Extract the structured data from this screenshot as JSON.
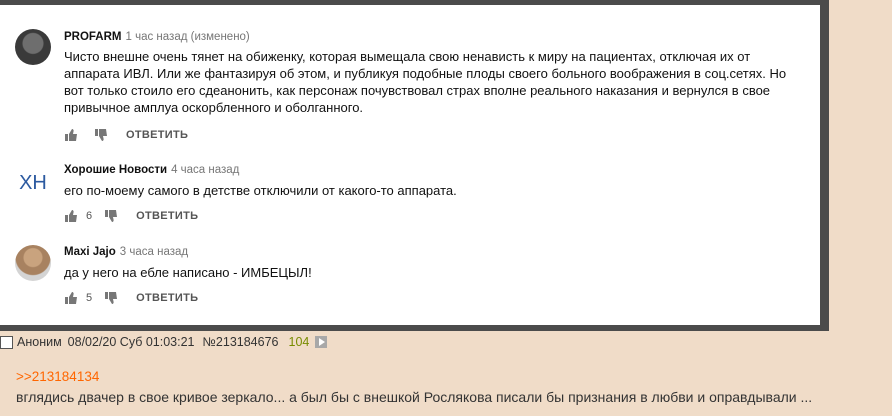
{
  "comments": [
    {
      "author": "PROFARM",
      "time": "1 час назад (изменено)",
      "text": "Чисто внешне очень тянет на обиженку, которая вымещала свою ненависть к миру на пациентах, отключая их от аппарата ИВЛ. Или же фантазируя об этом, и публикуя подобные плоды своего больного воображения в соц.сетях. Но вот только стоило его сдеанонить, как персонаж почувствовал страх вполне реального наказания и вернулся в свое привычное амплуа оскорбленного и оболганного.",
      "likes": "",
      "reply_label": "ОТВЕТИТЬ"
    },
    {
      "author": "Хорошие Новости",
      "time": "4 часа назад",
      "text": "его по-моему самого в детстве отключили от какого-то аппарата.",
      "likes": "6",
      "reply_label": "ОТВЕТИТЬ",
      "avatar_text": "ХН"
    },
    {
      "author": "Maxi Jajo",
      "time": "3 часа назад",
      "text": "да у него на ебле написано - ИМБЕЦЫЛ!",
      "likes": "5",
      "reply_label": "ОТВЕТИТЬ"
    }
  ],
  "post": {
    "author": "Аноним",
    "date": "08/02/20 Суб 01:03:21",
    "number": "№213184676",
    "replies": "104",
    "quote": ">>213184134",
    "text": "вглядись двачер в свое кривое зеркало... а был бы с внешкой Рослякова писали бы признания в любви и оправдывали ..."
  },
  "colors": {
    "reply_count": "#788c00",
    "quote_link": "#ff6600",
    "board_bg": "#f0dcc8"
  }
}
